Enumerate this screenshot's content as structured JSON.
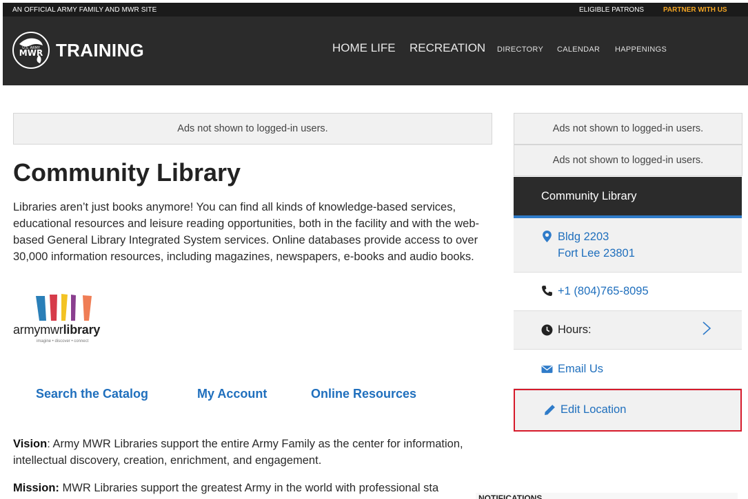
{
  "topbar": {
    "official": "AN OFFICIAL ARMY FAMILY AND MWR SITE",
    "eligible": "ELIGIBLE PATRONS",
    "partner": "PARTNER WITH US"
  },
  "header": {
    "logo_top": "U.S. ARMY",
    "logo_main": "MWR",
    "brand": "TRAINING",
    "nav_primary": [
      "HOME LIFE",
      "RECREATION"
    ],
    "nav_secondary": [
      "DIRECTORY",
      "CALENDAR",
      "HAPPENINGS"
    ]
  },
  "ads": {
    "main": "Ads not shown to logged-in users.",
    "side_1": "Ads not shown to logged-in users.",
    "side_2": "Ads not shown to logged-in users."
  },
  "main": {
    "title": "Community Library",
    "intro": "Libraries aren’t just books anymore! You can find all kinds of knowledge-based services, educational resources and leisure reading opportunities, both in the facility and with the web-based General Library Integrated System services. Online databases provide access to over 30,000 information resources, including magazines, newspapers, e-books and audio books.",
    "library_logo": {
      "part1": "army",
      "part2": "mwr",
      "part3": "library",
      "tagline": "imagine • discover • connect",
      "colors": [
        "#2a7fb8",
        "#d63b4a",
        "#f3c324",
        "#8a3f8f",
        "#ef7d55",
        "#1f6aa5"
      ]
    },
    "links": [
      "Search the Catalog",
      "My Account",
      "Online Resources"
    ],
    "vision_label": "Vision",
    "vision_text": ": Army MWR Libraries support the entire Army Family as the center for information, intellectual discovery, creation, enrichment, and engagement.",
    "mission_label": "Mission:",
    "mission_text": " MWR Libraries support the greatest Army in the world with professional sta"
  },
  "sidebar": {
    "title": "Community Library",
    "address_line1": "Bldg 2203",
    "address_line2": "Fort Lee 23801",
    "phone": "+1 (804)765-8095",
    "hours_label": "Hours:",
    "email": "Email Us",
    "edit": "Edit Location",
    "accent": "#2f7bc9",
    "highlight_color": "#d6192a"
  },
  "notifications": {
    "label": "NOTIFICATIONS"
  }
}
